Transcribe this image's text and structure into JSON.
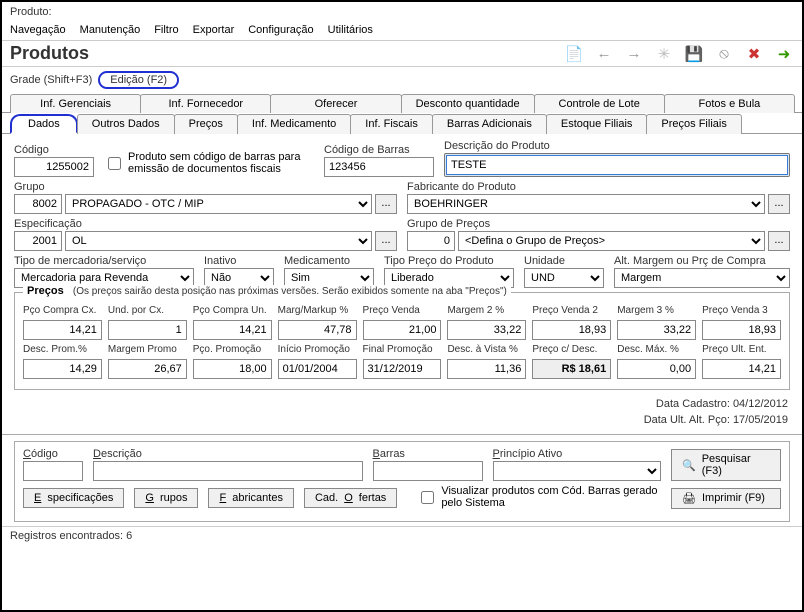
{
  "window": {
    "title_prefix": "Produto:"
  },
  "menu": [
    "Navegação",
    "Manutenção",
    "Filtro",
    "Exportar",
    "Configuração",
    "Utilitários"
  ],
  "header": {
    "title": "Produtos"
  },
  "mode": {
    "grade": "Grade (Shift+F3)",
    "edicao": "Edição (F2)"
  },
  "tabs_top": [
    "Inf. Gerenciais",
    "Inf. Fornecedor",
    "Oferecer",
    "Desconto quantidade",
    "Controle de Lote",
    "Fotos e Bula"
  ],
  "tabs_bottom": [
    "Dados",
    "Outros Dados",
    "Preços",
    "Inf. Medicamento",
    "Inf. Fiscais",
    "Barras Adicionais",
    "Estoque Filiais",
    "Preços Filiais"
  ],
  "form": {
    "codigo_lbl": "Código",
    "codigo_val": "1255002",
    "chk_sem_barras": "Produto sem código de barras para emissão de documentos fiscais",
    "cod_barras_lbl": "Código de Barras",
    "cod_barras_val": "123456",
    "desc_lbl": "Descrição do Produto",
    "desc_val": "TESTE",
    "grupo_lbl": "Grupo",
    "grupo_code": "8002",
    "grupo_val": "PROPAGADO - OTC / MIP",
    "fab_lbl": "Fabricante do Produto",
    "fab_val": "BOEHRINGER",
    "espec_lbl": "Especificação",
    "espec_code": "2001",
    "espec_val": "OL",
    "grp_precos_lbl": "Grupo de Preços",
    "grp_precos_code": "0",
    "grp_precos_val": "<Defina o Grupo de Preços>",
    "tipo_merc_lbl": "Tipo de mercadoria/serviço",
    "tipo_merc_val": "Mercadoria para Revenda",
    "inativo_lbl": "Inativo",
    "inativo_val": "Não",
    "medicamento_lbl": "Medicamento",
    "medicamento_val": "Sim",
    "tipo_preco_lbl": "Tipo Preço do Produto",
    "tipo_preco_val": "Liberado",
    "unidade_lbl": "Unidade",
    "unidade_val": "UND",
    "alt_margem_lbl": "Alt. Margem ou Prç de Compra",
    "alt_margem_val": "Margem"
  },
  "precos": {
    "legend": "Preços",
    "note": "(Os preços sairão desta posição nas próximas versões. Serão exibidos somente na aba \"Preços\")",
    "row1_labels": [
      "Pço Compra Cx.",
      "Und. por Cx.",
      "Pço Compra Un.",
      "Marg/Markup %",
      "Preço Venda",
      "Margem 2 %",
      "Preço Venda 2",
      "Margem 3 %",
      "Preço Venda 3"
    ],
    "row1_vals": [
      "14,21",
      "1",
      "14,21",
      "47,78",
      "21,00",
      "33,22",
      "18,93",
      "33,22",
      "18,93"
    ],
    "row2_labels": [
      "Desc. Prom.%",
      "Margem Promo",
      "Pço. Promoção",
      "Início Promoção",
      "Final Promoção",
      "Desc. à Vista %",
      "Preço c/ Desc.",
      "Desc. Máx. %",
      "Preço Ult. Ent."
    ],
    "row2_vals": [
      "14,29",
      "26,67",
      "18,00",
      "01/01/2004",
      "31/12/2019",
      "11,36",
      "R$ 18,61",
      "0,00",
      "14,21"
    ]
  },
  "meta": {
    "cadastro": "Data Cadastro:  04/12/2012",
    "ult_alt": "Data Ult. Alt. Pço:  17/05/2019"
  },
  "search": {
    "codigo_lbl": "Código",
    "descricao_lbl": "Descrição",
    "barras_lbl": "Barras",
    "principio_lbl": "Princípio Ativo",
    "pesquisar": "Pesquisar (F3)",
    "imprimir": "Imprimir (F9)",
    "espec_btn": "Especificações",
    "grupos_btn": "Grupos",
    "fab_btn": "Fabricantes",
    "cad_ofertas_btn": "Cad. Ofertas",
    "vis_check": "Visualizar produtos com Cód. Barras gerado pelo Sistema"
  },
  "status": "Registros encontrados: 6"
}
